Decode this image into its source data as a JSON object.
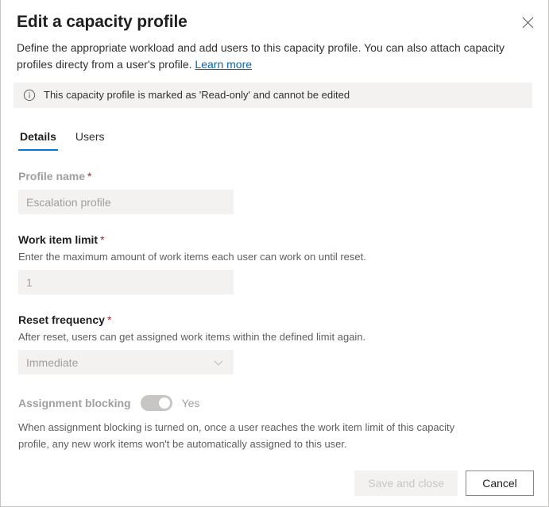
{
  "dialog": {
    "title": "Edit a capacity profile",
    "subtitle_part1": "Define the appropriate workload and add users to this capacity profile. You can also attach capacity profiles directy from a user's profile.",
    "learn_more_label": "Learn more",
    "close_icon": "close-icon"
  },
  "info_banner": {
    "icon": "info-circle-icon",
    "message": "This capacity profile is marked as 'Read-only' and cannot be edited",
    "background_color": "#f3f2f1"
  },
  "tabs": [
    {
      "label": "Details",
      "active": true
    },
    {
      "label": "Users",
      "active": false
    }
  ],
  "tab_accent_color": "#0078d4",
  "fields": {
    "profile_name": {
      "label": "Profile name",
      "required_marker": "*",
      "value": "Escalation profile",
      "disabled": true
    },
    "work_item_limit": {
      "label": "Work item limit",
      "required_marker": "*",
      "description": "Enter the maximum amount of work items each user can work on until reset.",
      "value": "1",
      "disabled": true
    },
    "reset_frequency": {
      "label": "Reset frequency",
      "required_marker": "*",
      "description": "After reset, users can get assigned work items within the defined limit again.",
      "value": "Immediate",
      "chevron_icon": "chevron-down-icon",
      "disabled": true
    },
    "assignment_blocking": {
      "label": "Assignment blocking",
      "state_label": "Yes",
      "checked": true,
      "disabled": true,
      "description": "When assignment blocking is turned on, once a user reaches the work item limit of this capacity profile, any new work items won't be automatically assigned to this user."
    }
  },
  "footer": {
    "save_label": "Save and close",
    "save_disabled": true,
    "cancel_label": "Cancel"
  },
  "colors": {
    "required_asterisk": "#a4262c",
    "link": "#0067b8",
    "field_background": "#f3f2f1",
    "disabled_text": "#a19f9d"
  }
}
